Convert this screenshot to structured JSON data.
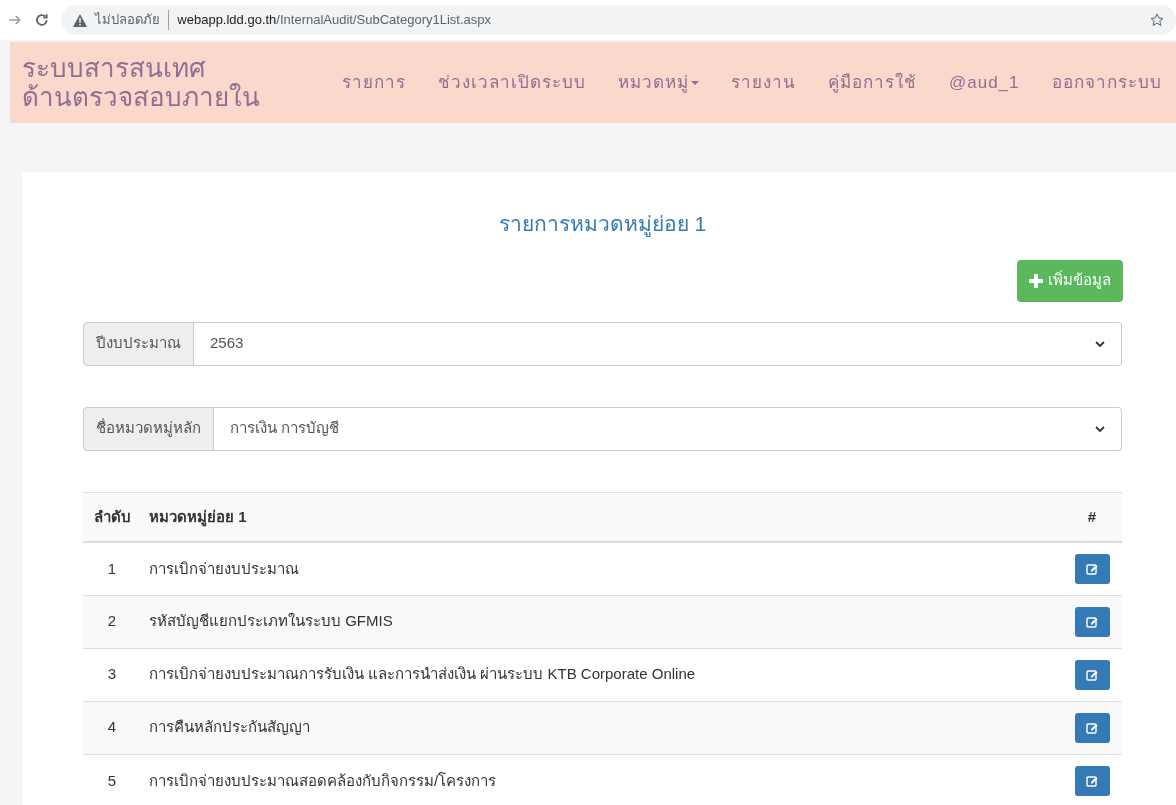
{
  "browser": {
    "security": "ไม่ปลอดภัย",
    "url_host": "webapp.ldd.go.th",
    "url_path": "/InternalAudit/SubCategory1List.aspx"
  },
  "site_title": [
    "ระบบสารสนเทศ",
    "ด้านตรวจสอบภายใน"
  ],
  "nav": [
    {
      "label": "รายการ",
      "dropdown": false
    },
    {
      "label": "ช่วงเวลาเปิดระบบ",
      "dropdown": false
    },
    {
      "label": "หมวดหมู่",
      "dropdown": true
    },
    {
      "label": "รายงาน",
      "dropdown": false
    },
    {
      "label": "คู่มือการใช้",
      "dropdown": false
    },
    {
      "label": "@aud_1",
      "dropdown": false
    },
    {
      "label": "ออกจากระบบ",
      "dropdown": false
    }
  ],
  "page_title": "รายการหมวดหมู่ย่อย 1",
  "add_button": "เพิ่มข้อมูล",
  "filters": [
    {
      "label": "ปีงบประมาณ",
      "value": "2563"
    },
    {
      "label": "ชื่อหมวดหมู่หลัก",
      "value": "การเงิน การบัญชี"
    }
  ],
  "table": {
    "columns": [
      "ลำดับ",
      "หมวดหมู่ย่อย 1",
      "#"
    ],
    "rows": [
      {
        "no": "1",
        "name": "การเบิกจ่ายงบประมาณ"
      },
      {
        "no": "2",
        "name": "รหัสบัญชีแยกประเภทในระบบ GFMIS"
      },
      {
        "no": "3",
        "name": "การเบิกจ่ายงบประมาณการรับเงิน และการนำส่งเงิน ผ่านระบบ KTB Corporate Online"
      },
      {
        "no": "4",
        "name": "การคืนหลักประกันสัญญา"
      },
      {
        "no": "5",
        "name": "การเบิกจ่ายงบประมาณสอดคล้องกับกิจกรรม/โครงการ"
      }
    ]
  }
}
